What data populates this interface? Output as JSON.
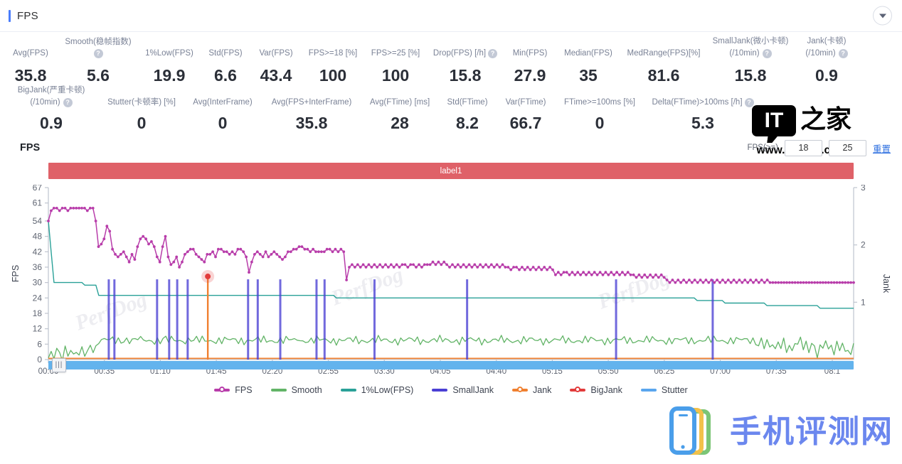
{
  "header": {
    "title": "FPS",
    "collapse_icon": "chevron-down-icon",
    "accent": "#4a7dfc"
  },
  "stats_rows": [
    [
      {
        "label": "Avg(FPS)",
        "value": "35.8",
        "help": false,
        "w": 78
      },
      {
        "label": "Smooth(稳帧指数)",
        "value": "5.6",
        "help": true,
        "w": 112
      },
      {
        "label": "1%Low(FPS)",
        "value": "19.9",
        "help": false,
        "w": 88
      },
      {
        "label": "Std(FPS)",
        "value": "6.6",
        "help": false,
        "w": 70
      },
      {
        "label": "Var(FPS)",
        "value": "43.4",
        "help": false,
        "w": 72
      },
      {
        "label": "FPS>=18 [%]",
        "value": "100",
        "help": false,
        "w": 88
      },
      {
        "label": "FPS>=25 [%]",
        "value": "100",
        "help": false,
        "w": 88
      },
      {
        "label": "Drop(FPS) [/h]",
        "value": "15.8",
        "help": true,
        "w": 108
      },
      {
        "label": "Min(FPS)",
        "value": "27.9",
        "help": false,
        "w": 74
      },
      {
        "label": "Median(FPS)",
        "value": "35",
        "help": false,
        "w": 90
      },
      {
        "label": "MedRange(FPS)[%]",
        "value": "81.6",
        "help": false,
        "w": 122
      },
      {
        "label": "SmallJank(微小卡顿)",
        "label2": "(/10min)",
        "value": "15.8",
        "help": true,
        "w": 122
      },
      {
        "label": "Jank(卡顿)",
        "label2": "(/10min)",
        "value": "0.9",
        "help": true,
        "w": 92
      }
    ],
    [
      {
        "label": "BigJank(严重卡顿)",
        "label2": "(/10min)",
        "value": "0.9",
        "help": true,
        "w": 136
      },
      {
        "label": "Stutter(卡顿率) [%]",
        "value": "0",
        "help": false,
        "w": 118
      },
      {
        "label": "Avg(InterFrame)",
        "value": "0",
        "help": false,
        "w": 110
      },
      {
        "label": "Avg(FPS+InterFrame)",
        "value": "35.8",
        "help": false,
        "w": 140
      },
      {
        "label": "Avg(FTime) [ms]",
        "value": "28",
        "help": false,
        "w": 108
      },
      {
        "label": "Std(FTime)",
        "value": "8.2",
        "help": false,
        "w": 82
      },
      {
        "label": "Var(FTime)",
        "value": "66.7",
        "help": false,
        "w": 82
      },
      {
        "label": "FTime>=100ms [%]",
        "value": "0",
        "help": false,
        "w": 126
      },
      {
        "label": "Delta(FTime)>100ms [/h]",
        "value": "5.3",
        "help": true,
        "w": 164
      }
    ]
  ],
  "chart_head": {
    "title": "FPS",
    "fps_label": "FPS(>=)",
    "threshold_low": "18",
    "threshold_high": "25",
    "reset_label": "重置"
  },
  "label_bar": {
    "text": "label1",
    "color": "#df6168"
  },
  "legend": [
    {
      "name": "FPS",
      "color": "#b83daa",
      "marker": true
    },
    {
      "name": "Smooth",
      "color": "#62b467",
      "marker": false
    },
    {
      "name": "1%Low(FPS)",
      "color": "#2aa198",
      "marker": false
    },
    {
      "name": "SmallJank",
      "color": "#4a3fd4",
      "marker": false
    },
    {
      "name": "Jank",
      "color": "#f08030",
      "marker": true
    },
    {
      "name": "BigJank",
      "color": "#e23b3b",
      "marker": true
    },
    {
      "name": "Stutter",
      "color": "#5aa6ee",
      "marker": false
    }
  ],
  "slider": {
    "handle_icon": "drag-grip-icon",
    "fill_color": "#63b3ed"
  },
  "watermarks": {
    "perfdog": "PerfDog",
    "ithome_mark": "IT",
    "ithome_cn": "之家",
    "ithome_url": "www.ithome.com",
    "review_site": "手机评测网"
  },
  "chart_data": {
    "type": "line",
    "title": "FPS",
    "xlabel": "",
    "ylabel": "FPS",
    "y2label": "Jank",
    "xticks": [
      "00:00",
      "00:35",
      "01:10",
      "01:45",
      "02:20",
      "02:55",
      "03:30",
      "04:05",
      "04:40",
      "05:15",
      "05:50",
      "06:25",
      "07:00",
      "07:35",
      "08:1"
    ],
    "yticks": [
      0,
      6,
      12,
      18,
      24,
      30,
      36,
      42,
      48,
      54,
      61,
      67
    ],
    "ylim": [
      0,
      67
    ],
    "y2ticks": [
      1,
      2,
      3
    ],
    "y2lim": [
      0,
      3
    ],
    "grid": false,
    "legend_position": "bottom",
    "series": [
      {
        "name": "FPS",
        "color": "#b83daa",
        "axis": "left",
        "marker": true,
        "values": [
          54,
          58,
          59,
          59,
          58,
          59,
          59,
          58,
          59,
          59,
          59,
          59,
          59,
          59,
          58,
          59,
          59,
          54,
          44,
          45,
          47,
          52,
          50,
          43,
          41,
          40,
          41,
          42,
          40,
          38,
          41,
          39,
          44,
          47,
          48,
          47,
          45,
          46,
          44,
          40,
          38,
          44,
          48,
          40,
          37,
          38,
          40,
          36,
          38,
          41,
          42,
          43,
          43,
          41,
          40,
          39,
          38,
          41,
          41,
          42,
          40,
          43,
          43,
          42,
          42,
          41,
          42,
          41,
          43,
          43,
          42,
          40,
          34,
          38,
          41,
          42,
          41,
          40,
          42,
          40,
          41,
          42,
          41,
          40,
          39,
          40,
          42,
          42,
          43,
          43,
          44,
          44,
          43,
          43,
          42,
          43,
          42,
          42,
          42,
          42,
          43,
          43,
          42,
          43,
          42,
          43,
          42,
          31,
          36,
          37,
          36,
          37,
          36,
          37,
          36,
          37,
          36,
          37,
          36,
          37,
          36,
          37,
          36,
          37,
          36,
          37,
          36,
          37,
          37,
          36,
          37,
          37,
          36,
          37,
          36,
          37,
          37,
          37,
          38,
          37,
          38,
          37,
          38,
          37,
          36,
          37,
          36,
          37,
          36,
          37,
          36,
          37,
          36,
          37,
          36,
          37,
          36,
          37,
          36,
          37,
          36,
          37,
          36,
          37,
          36,
          36,
          35,
          36,
          36,
          35,
          36,
          35,
          36,
          35,
          36,
          35,
          36,
          35,
          36,
          35,
          36,
          35,
          33,
          34,
          33,
          34,
          34,
          33,
          34,
          33,
          34,
          33,
          34,
          33,
          34,
          33,
          34,
          33,
          34,
          33,
          34,
          33,
          34,
          33,
          34,
          33,
          34,
          33,
          34,
          33,
          33,
          32,
          33,
          32,
          33,
          32,
          33,
          32,
          33,
          32,
          33,
          32,
          31,
          30,
          31,
          30,
          31,
          30,
          31,
          30,
          31,
          30,
          31,
          30,
          31,
          30,
          31,
          30,
          31,
          30,
          31,
          30,
          31,
          30,
          31,
          30,
          31,
          30,
          31,
          30,
          31,
          30,
          31,
          30,
          31,
          30,
          31,
          30,
          31,
          30,
          30,
          30,
          30,
          30,
          30,
          30,
          30,
          30,
          30,
          30,
          30,
          30,
          30,
          30,
          30,
          30,
          30,
          30,
          30,
          30,
          30,
          30,
          30,
          30,
          30,
          30,
          30,
          30,
          30,
          30
        ]
      },
      {
        "name": "1%Low(FPS)",
        "color": "#2aa198",
        "axis": "left",
        "marker": false,
        "values": [
          54,
          42,
          30,
          30,
          30,
          30,
          30,
          30,
          30,
          30,
          30,
          30,
          30,
          29,
          29,
          29,
          29,
          29,
          25,
          25,
          25,
          25,
          25,
          25,
          25,
          25,
          25,
          25,
          25,
          25,
          25,
          25,
          25,
          25,
          25,
          25,
          25,
          25,
          25,
          25,
          25,
          25,
          25,
          25,
          25,
          25,
          25,
          25,
          25,
          25,
          25,
          25,
          25,
          25,
          25,
          25,
          25,
          25,
          25,
          25,
          25,
          25,
          25,
          25,
          25,
          25,
          25,
          25,
          25,
          25,
          25,
          25,
          25,
          25,
          25,
          25,
          25,
          25,
          25,
          25,
          25,
          25,
          25,
          25,
          25,
          25,
          25,
          25,
          25,
          25,
          25,
          25,
          25,
          25,
          25,
          25,
          25,
          25,
          25,
          25,
          25,
          25,
          25,
          24,
          24,
          24,
          24,
          24,
          24,
          24,
          24,
          24,
          24,
          24,
          24,
          24,
          24,
          24,
          24,
          24,
          24,
          24,
          24,
          24,
          24,
          24,
          24,
          24,
          24,
          24,
          24,
          24,
          24,
          24,
          24,
          24,
          24,
          24,
          24,
          24,
          24,
          24,
          24,
          24,
          24,
          24,
          24,
          24,
          24,
          24,
          24,
          24,
          24,
          24,
          24,
          24,
          24,
          24,
          24,
          24,
          24,
          24,
          24,
          24,
          24,
          24,
          24,
          24,
          24,
          24,
          24,
          24,
          24,
          24,
          24,
          24,
          24,
          24,
          24,
          24,
          24,
          24,
          24,
          24,
          24,
          24,
          24,
          24,
          24,
          24,
          24,
          24,
          24,
          24,
          24,
          24,
          24,
          24,
          24,
          24,
          24,
          24,
          24,
          24,
          24,
          24,
          24,
          24,
          24,
          24,
          24,
          24,
          24,
          24,
          24,
          24,
          24,
          24,
          24,
          24,
          24,
          24,
          24,
          24,
          24,
          24,
          24,
          24,
          24,
          24,
          24,
          24,
          23,
          23,
          23,
          23,
          23,
          23,
          23,
          23,
          23,
          23,
          22,
          22,
          22,
          22,
          22,
          22,
          22,
          22,
          22,
          22,
          22,
          22,
          22,
          22,
          22,
          21,
          21,
          21,
          21,
          21,
          21,
          21,
          21,
          21,
          21,
          21,
          21,
          21,
          21,
          21,
          21,
          21,
          21,
          21,
          20,
          20,
          20,
          20,
          20,
          20,
          20,
          20,
          20,
          20,
          20,
          20,
          20
        ]
      },
      {
        "name": "Smooth",
        "color": "#62b467",
        "axis": "left",
        "marker": false,
        "values": [
          0,
          2,
          1,
          4,
          3,
          1,
          5,
          2,
          4,
          1,
          3,
          1,
          4,
          2,
          3,
          6,
          4,
          5,
          7,
          8,
          7,
          8,
          7,
          8,
          7,
          8,
          7,
          8,
          8,
          7,
          8,
          7,
          8,
          8,
          7,
          8,
          7,
          8,
          7,
          8,
          7,
          8,
          8,
          7,
          8,
          7,
          8,
          7,
          8,
          7,
          8,
          8,
          7,
          8,
          7,
          8,
          7,
          8,
          7,
          8,
          7,
          8,
          7,
          8,
          7,
          8,
          7,
          8,
          7,
          8,
          7,
          8,
          7,
          8,
          7,
          8,
          7,
          8,
          7,
          8,
          7,
          8,
          7,
          8,
          7,
          8,
          7,
          8,
          7,
          8,
          8,
          7,
          8,
          7,
          8,
          7,
          8,
          7,
          8,
          7,
          8,
          7,
          8,
          7,
          8,
          7,
          8,
          7,
          8,
          7,
          8,
          7,
          8,
          7,
          8,
          7,
          8,
          7,
          8,
          7,
          8,
          7,
          8,
          7,
          8,
          7,
          8,
          7,
          8,
          7,
          8,
          7,
          8,
          7,
          8,
          7,
          8,
          7,
          8,
          7,
          8,
          7,
          8,
          7,
          8,
          7,
          8,
          7,
          8,
          7,
          8,
          7,
          8,
          7,
          8,
          7,
          8,
          7,
          8,
          7,
          8,
          7,
          8,
          7,
          8,
          7,
          8,
          7,
          8,
          7,
          8,
          7,
          8,
          7,
          8,
          7,
          8,
          7,
          8,
          7,
          8,
          7,
          8,
          7,
          8,
          7,
          8,
          7,
          8,
          7,
          8,
          7,
          8,
          7,
          8,
          7,
          8,
          7,
          8,
          7,
          8,
          7,
          8,
          7,
          8,
          7,
          8,
          7,
          8,
          7,
          8,
          7,
          8,
          7,
          8,
          7,
          8,
          7,
          8,
          7,
          8,
          7,
          8,
          7,
          8,
          7,
          8,
          7,
          8,
          7,
          8,
          7,
          8,
          7,
          8,
          7,
          8,
          7,
          8,
          7,
          8,
          7,
          8,
          7,
          8,
          7,
          8,
          7,
          8,
          7,
          8,
          7,
          8,
          7,
          6,
          8,
          5,
          7,
          4,
          6,
          3,
          7,
          5,
          8,
          4,
          6,
          3,
          7,
          5,
          8,
          4,
          6,
          3,
          7,
          5,
          2,
          6,
          4,
          8,
          3,
          5,
          2,
          6,
          4,
          7,
          3,
          5,
          2,
          6
        ]
      },
      {
        "name": "SmallJank",
        "color": "#4a3fd4",
        "axis": "right",
        "marker": false,
        "spikes_x_pct": [
          7.5,
          8.2,
          13.5,
          15.0,
          16.0,
          17.3,
          24.8,
          26.0,
          28.8,
          33.3,
          34.3,
          40.5,
          52.0,
          70.5,
          82.5
        ],
        "spike_value": 1.4
      },
      {
        "name": "Jank",
        "color": "#f08030",
        "axis": "right",
        "marker": true,
        "baseline": 0.02,
        "spikes_x_pct": [
          19.8
        ],
        "spike_value": 1.45,
        "highlighted_point": {
          "x_pct": 19.8,
          "y": 1.45
        }
      },
      {
        "name": "BigJank",
        "color": "#e23b3b",
        "axis": "right",
        "marker": true,
        "values": []
      },
      {
        "name": "Stutter",
        "color": "#5aa6ee",
        "axis": "right",
        "values": []
      }
    ]
  }
}
